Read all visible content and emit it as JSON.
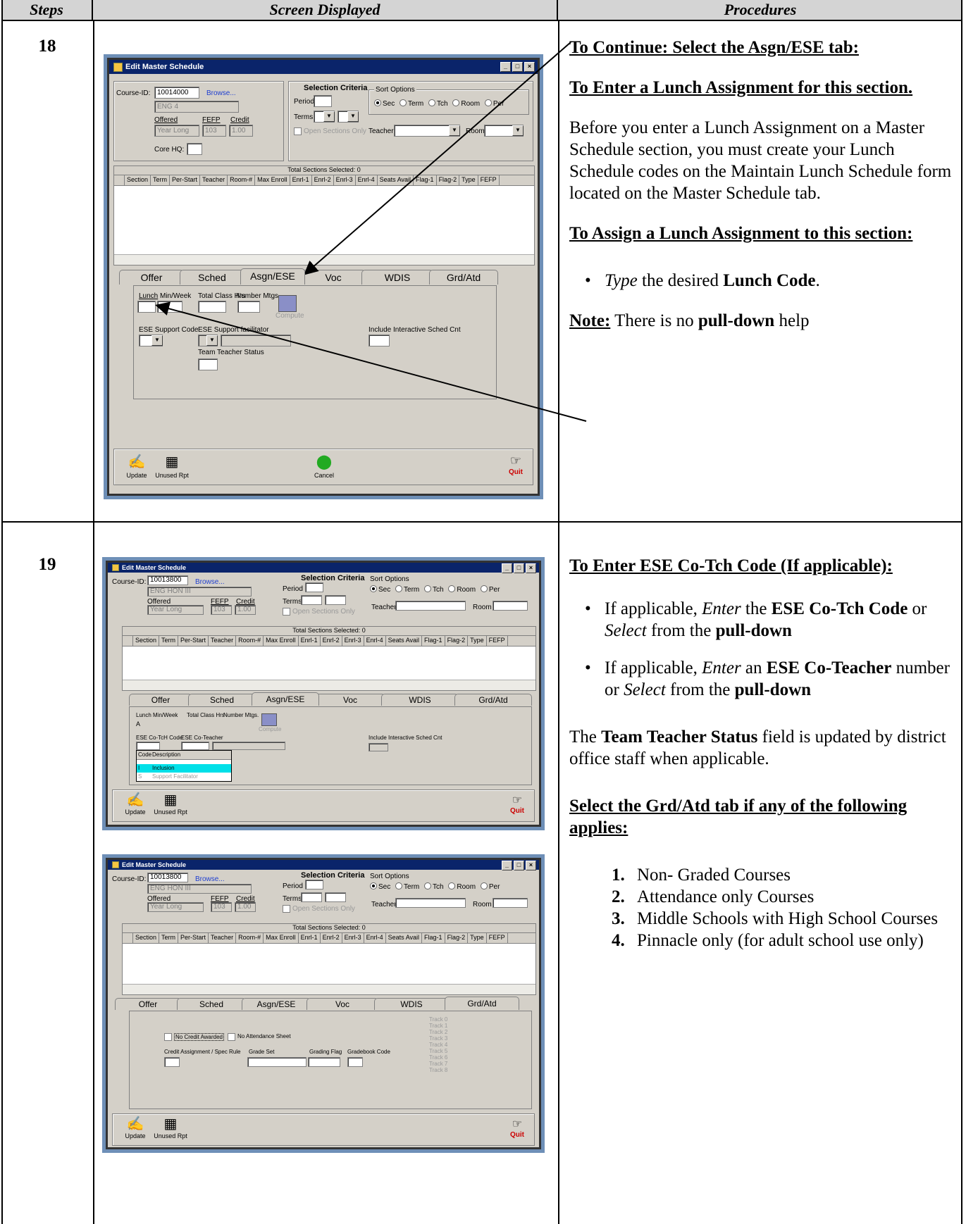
{
  "table": {
    "headers": [
      "Steps",
      "Screen Displayed",
      "Procedures"
    ]
  },
  "step18": {
    "number": "18",
    "window": {
      "title": "Edit Master Schedule",
      "course_id_label": "Course-ID:",
      "course_id": "10014000",
      "browse": "Browse...",
      "course_name": "ENG 4",
      "offered_label": "Offered",
      "offered": "Year Long",
      "fefp_label": "FEFP",
      "fefp": "103",
      "credit_label": "Credit",
      "credit": "1.00",
      "core_hq_label": "Core HQ:",
      "selection_criteria": "Selection Criteria",
      "period_label": "Period",
      "terms_label": "Terms",
      "open_sections": "Open Sections Only",
      "sort_options_label": "Sort Options",
      "sort_options": [
        "Sec",
        "Term",
        "Tch",
        "Room",
        "Per"
      ],
      "teacher_label": "Teacher",
      "room_label": "Room",
      "grid_caption": "Total Sections Selected: 0",
      "grid_columns": [
        "Section",
        "Term",
        "Per-Start",
        "Teacher",
        "Room-#",
        "Max Enroll",
        "Enrl-1",
        "Enrl-2",
        "Enrl-3",
        "Enrl-4",
        "Seats Avail",
        "Flag-1",
        "Flag-2",
        "Type",
        "FEFP"
      ],
      "tabs": [
        "Offer",
        "Sched",
        "Asgn/ESE",
        "Voc",
        "WDIS",
        "Grd/Atd"
      ],
      "lunch_label": "Lunch",
      "min_week_label": "Min/Week",
      "total_class_hrs_label": "Total Class Hrs",
      "number_mtgs_label": "Number Mtgs.",
      "compute": "Compute",
      "ese_support_code_label": "ESE Support  Code",
      "ese_support_facilitator_label": "ESE Support facilitator",
      "include_interactive_label": "Include Interactive Sched Cnt",
      "team_teacher_status_label": "Team Teacher Status",
      "update": "Update",
      "unused_rpt": "Unused Rpt",
      "cancel": "Cancel",
      "quit": "Quit"
    },
    "procedures": {
      "h1": "To Continue: Select the Asgn/ESE tab:",
      "h2": "To Enter a Lunch Assignment for this section.",
      "para": "Before you enter a Lunch Assignment on a Master Schedule section, you must create your Lunch Schedule codes on the Maintain Lunch Schedule form located on the Master Schedule tab.",
      "h3": "To Assign a Lunch Assignment to this section:",
      "bullet_type": "Type",
      "bullet_the": " the desired ",
      "bullet_lunch_code": "Lunch Code",
      "bullet_end": ".",
      "note_label": "Note:",
      "note_text1": " There is no ",
      "note_bold": "pull-down",
      "note_text2": " help"
    }
  },
  "step19": {
    "number": "19",
    "window_a": {
      "title": "Edit Master Schedule",
      "course_id_label": "Course-ID:",
      "course_id": "10013800",
      "browse": "Browse...",
      "course_name": "ENG HON III",
      "offered_label": "Offered",
      "offered": "Year Long",
      "fefp_label": "FEFP",
      "fefp": "103",
      "credit_label": "Credit",
      "credit": "1.00",
      "selection_criteria": "Selection Criteria",
      "period_label": "Period",
      "terms_label": "Terms",
      "open_sections": "Open Sections Only",
      "sort_options_label": "Sort Options",
      "sort_options": [
        "Sec",
        "Term",
        "Tch",
        "Room",
        "Per"
      ],
      "teacher_label": "Teacher",
      "room_label": "Room",
      "grid_caption": "Total Sections Selected: 0",
      "grid_columns": [
        "Section",
        "Term",
        "Per-Start",
        "Teacher",
        "Room-#",
        "Max Enroll",
        "Enrl-1",
        "Enrl-2",
        "Enrl-3",
        "Enrl-4",
        "Seats Avail",
        "Flag-1",
        "Flag-2",
        "Type",
        "FEFP"
      ],
      "tabs": [
        "Offer",
        "Sched",
        "Asgn/ESE",
        "Voc",
        "WDIS",
        "Grd/Atd"
      ],
      "lunch_label": "Lunch",
      "lunch_value": "A",
      "min_week_label": "Min/Week",
      "total_class_hrs_label": "Total Class Hrs",
      "number_mtgs_label": "Number Mtgs.",
      "compute": "Compute",
      "ese_cotch_code_label": "ESE Co-TcH  Code",
      "ese_coteacher_label": "ESE Co-Teacher",
      "include_interactive_label": "Include Interactive Sched Cnt",
      "popup_header": [
        "Code",
        "Description"
      ],
      "popup_rows": [
        [
          "I",
          "Inclusion"
        ],
        [
          "S",
          "Support Facilitator"
        ]
      ],
      "update": "Update",
      "unused_rpt": "Unused Rpt",
      "quit": "Quit"
    },
    "window_b": {
      "title": "Edit Master Schedule",
      "course_id_label": "Course-ID:",
      "course_id": "10013800",
      "browse": "Browse...",
      "course_name": "ENG HON III",
      "offered_label": "Offered",
      "offered": "Year Long",
      "fefp_label": "FEFP",
      "fefp": "103",
      "credit_label": "Credit",
      "credit": "1.00",
      "selection_criteria": "Selection Criteria",
      "period_label": "Period",
      "terms_label": "Terms",
      "open_sections": "Open Sections Only",
      "sort_options_label": "Sort Options",
      "sort_options": [
        "Sec",
        "Term",
        "Tch",
        "Room",
        "Per"
      ],
      "teacher_label": "Teacher",
      "room_label": "Room",
      "grid_caption": "Total Sections Selected: 0",
      "grid_columns": [
        "Section",
        "Term",
        "Per-Start",
        "Teacher",
        "Room-#",
        "Max Enroll",
        "Enrl-1",
        "Enrl-2",
        "Enrl-3",
        "Enrl-4",
        "Seats Avail",
        "Flag-1",
        "Flag-2",
        "Type",
        "FEFP"
      ],
      "tabs": [
        "Offer",
        "Sched",
        "Asgn/ESE",
        "Voc",
        "WDIS",
        "Grd/Atd"
      ],
      "no_credit_awarded": "No Credit Awarded",
      "no_attendance_sheet": "No Attendance Sheet",
      "credit_assignment_label": "Credit Assignment / Spec Rule",
      "grade_set_label": "Grade Set",
      "grading_flag_label": "Grading Flag",
      "gradebook_code_label": "Gradebook Code",
      "tracks": [
        "Track 0",
        "Track 1",
        "Track 2",
        "Track 3",
        "Track 4",
        "Track 5",
        "Track 6",
        "Track 7",
        "Track 8"
      ],
      "update": "Update",
      "unused_rpt": "Unused Rpt",
      "quit": "Quit"
    },
    "procedures": {
      "h1": "To Enter ESE Co-Tch Code (If applicable):",
      "b1_pre": "If applicable, ",
      "b1_enter": "Enter",
      "b1_the": " the ",
      "b1_code": "ESE Co-Tch Code",
      "b1_or": " or ",
      "b1_select": "Select",
      "b1_from": " from the ",
      "b1_pulldown": "pull-down",
      "b2_pre": "If applicable, ",
      "b2_enter": "Enter",
      "b2_an": " an ",
      "b2_teacher": "ESE Co-Teacher",
      "b2_number": " number or ",
      "b2_select": "Select",
      "b2_from": " from the ",
      "b2_pulldown": "pull-down",
      "p_the": "The ",
      "p_team": "Team Teacher Status",
      "p_rest": " field is updated by district office staff when applicable.",
      "h2": "Select the Grd/Atd tab if any of the following applies:",
      "list": [
        {
          "n": "1.",
          "t": "Non- Graded Courses"
        },
        {
          "n": "2.",
          "t": "Attendance only Courses"
        },
        {
          "n": "3.",
          "t": "Middle Schools with High School Courses"
        },
        {
          "n": "4.",
          "t": "Pinnacle only (for adult school use only)"
        }
      ]
    }
  }
}
